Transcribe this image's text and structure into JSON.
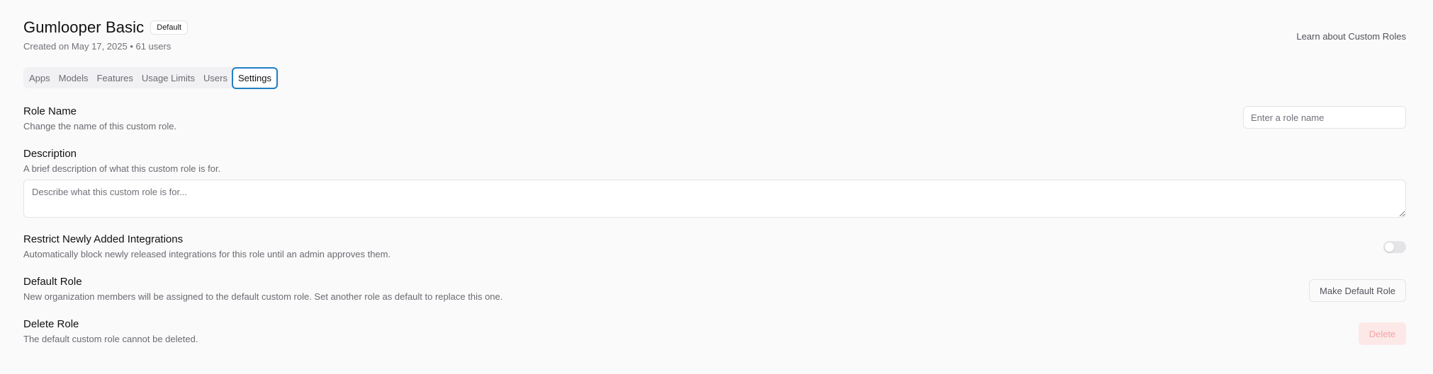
{
  "role": {
    "title": "Gumlooper Basic",
    "badge": "Default",
    "subtitle": "Created on May 17, 2025 • 61 users"
  },
  "header": {
    "learn_link": "Learn about Custom Roles"
  },
  "tabs": [
    {
      "label": "Apps",
      "active": false
    },
    {
      "label": "Models",
      "active": false
    },
    {
      "label": "Features",
      "active": false
    },
    {
      "label": "Usage Limits",
      "active": false
    },
    {
      "label": "Users",
      "active": false
    },
    {
      "label": "Settings",
      "active": true
    }
  ],
  "settings": {
    "role_name": {
      "title": "Role Name",
      "description": "Change the name of this custom role.",
      "placeholder": "Enter a role name",
      "value": ""
    },
    "description": {
      "title": "Description",
      "description": "A brief description of what this custom role is for.",
      "placeholder": "Describe what this custom role is for...",
      "value": ""
    },
    "restrict": {
      "title": "Restrict Newly Added Integrations",
      "description": "Automatically block newly released integrations for this role until an admin approves them.",
      "enabled": false
    },
    "default_role": {
      "title": "Default Role",
      "description": "New organization members will be assigned to the default custom role. Set another role as default to replace this one.",
      "button_label": "Make Default Role"
    },
    "delete_role": {
      "title": "Delete Role",
      "description": "The default custom role cannot be deleted.",
      "button_label": "Delete",
      "disabled": true
    }
  },
  "colors": {
    "accent_focus": "#1f7fc4",
    "delete_bg": "#fde8e8",
    "delete_text": "#f4a5a5"
  }
}
